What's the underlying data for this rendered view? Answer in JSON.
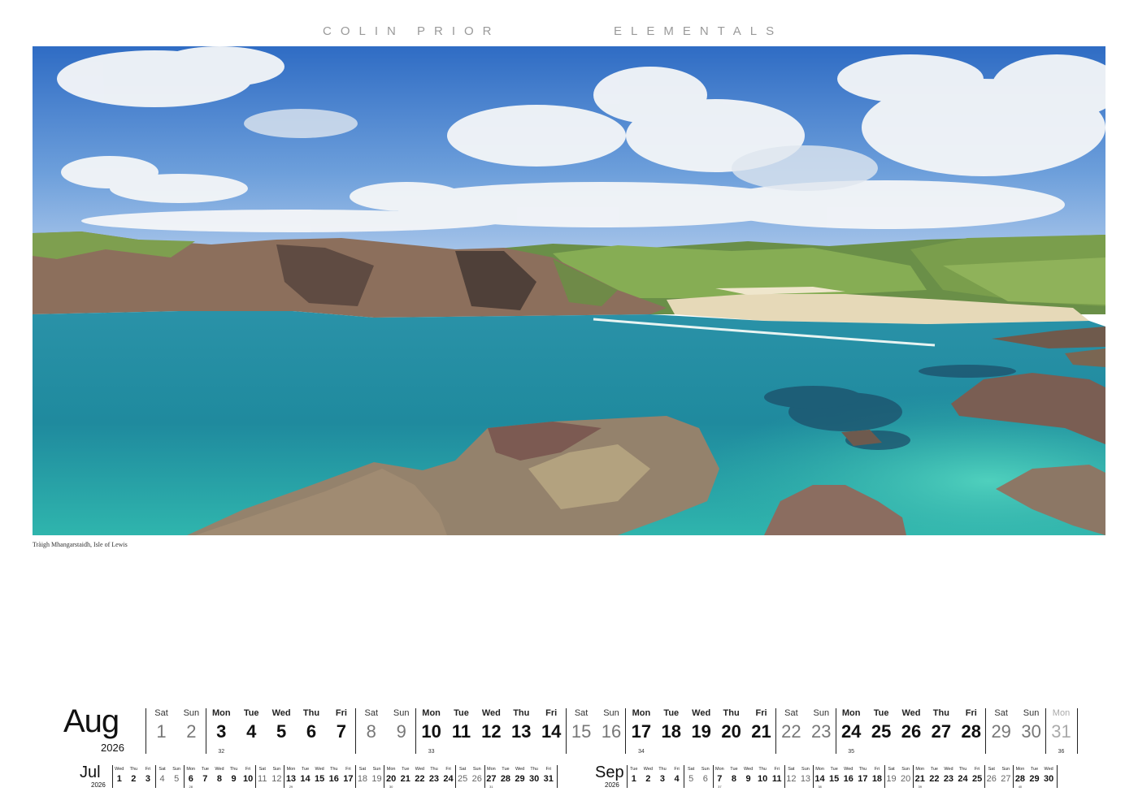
{
  "header": {
    "artist": "COLIN PRIOR",
    "series": "ELEMENTALS"
  },
  "photo": {
    "caption": "Tràigh Mhangarstaidh, Isle of Lewis"
  },
  "colors": {
    "sky": "#3f78c8",
    "water": "#1f8fa0",
    "turquoise": "#37c0b3",
    "rock": "#8a6d5e",
    "grass": "#7fa347",
    "sand": "#e8dcc0"
  },
  "main_month": {
    "name": "Aug",
    "year": "2026",
    "days": [
      {
        "dn": "Sat",
        "d": "1",
        "type": "we"
      },
      {
        "dn": "Sun",
        "d": "2",
        "type": "we"
      },
      {
        "dn": "Mon",
        "d": "3",
        "type": "wk",
        "wn": "32"
      },
      {
        "dn": "Tue",
        "d": "4",
        "type": "wk"
      },
      {
        "dn": "Wed",
        "d": "5",
        "type": "wk"
      },
      {
        "dn": "Thu",
        "d": "6",
        "type": "wk"
      },
      {
        "dn": "Fri",
        "d": "7",
        "type": "wk"
      },
      {
        "dn": "Sat",
        "d": "8",
        "type": "we"
      },
      {
        "dn": "Sun",
        "d": "9",
        "type": "we"
      },
      {
        "dn": "Mon",
        "d": "10",
        "type": "wk",
        "wn": "33"
      },
      {
        "dn": "Tue",
        "d": "11",
        "type": "wk"
      },
      {
        "dn": "Wed",
        "d": "12",
        "type": "wk"
      },
      {
        "dn": "Thu",
        "d": "13",
        "type": "wk"
      },
      {
        "dn": "Fri",
        "d": "14",
        "type": "wk"
      },
      {
        "dn": "Sat",
        "d": "15",
        "type": "we"
      },
      {
        "dn": "Sun",
        "d": "16",
        "type": "we"
      },
      {
        "dn": "Mon",
        "d": "17",
        "type": "wk",
        "wn": "34"
      },
      {
        "dn": "Tue",
        "d": "18",
        "type": "wk"
      },
      {
        "dn": "Wed",
        "d": "19",
        "type": "wk"
      },
      {
        "dn": "Thu",
        "d": "20",
        "type": "wk"
      },
      {
        "dn": "Fri",
        "d": "21",
        "type": "wk"
      },
      {
        "dn": "Sat",
        "d": "22",
        "type": "we"
      },
      {
        "dn": "Sun",
        "d": "23",
        "type": "we"
      },
      {
        "dn": "Mon",
        "d": "24",
        "type": "wk",
        "wn": "35"
      },
      {
        "dn": "Tue",
        "d": "25",
        "type": "wk"
      },
      {
        "dn": "Wed",
        "d": "26",
        "type": "wk"
      },
      {
        "dn": "Thu",
        "d": "27",
        "type": "wk"
      },
      {
        "dn": "Fri",
        "d": "28",
        "type": "wk"
      },
      {
        "dn": "Sat",
        "d": "29",
        "type": "we"
      },
      {
        "dn": "Sun",
        "d": "30",
        "type": "we"
      },
      {
        "dn": "Mon",
        "d": "31",
        "type": "next",
        "wn": "36"
      }
    ]
  },
  "prev_month": {
    "name": "Jul",
    "year": "2026",
    "days": [
      {
        "dn": "Wed",
        "d": "1",
        "type": "wk"
      },
      {
        "dn": "Thu",
        "d": "2",
        "type": "wk"
      },
      {
        "dn": "Fri",
        "d": "3",
        "type": "wk"
      },
      {
        "dn": "Sat",
        "d": "4",
        "type": "we"
      },
      {
        "dn": "Sun",
        "d": "5",
        "type": "we"
      },
      {
        "dn": "Mon",
        "d": "6",
        "type": "wk",
        "wn": "28"
      },
      {
        "dn": "Tue",
        "d": "7",
        "type": "wk"
      },
      {
        "dn": "Wed",
        "d": "8",
        "type": "wk"
      },
      {
        "dn": "Thu",
        "d": "9",
        "type": "wk"
      },
      {
        "dn": "Fri",
        "d": "10",
        "type": "wk"
      },
      {
        "dn": "Sat",
        "d": "11",
        "type": "we"
      },
      {
        "dn": "Sun",
        "d": "12",
        "type": "we"
      },
      {
        "dn": "Mon",
        "d": "13",
        "type": "wk",
        "wn": "29"
      },
      {
        "dn": "Tue",
        "d": "14",
        "type": "wk"
      },
      {
        "dn": "Wed",
        "d": "15",
        "type": "wk"
      },
      {
        "dn": "Thu",
        "d": "16",
        "type": "wk"
      },
      {
        "dn": "Fri",
        "d": "17",
        "type": "wk"
      },
      {
        "dn": "Sat",
        "d": "18",
        "type": "we"
      },
      {
        "dn": "Sun",
        "d": "19",
        "type": "we"
      },
      {
        "dn": "Mon",
        "d": "20",
        "type": "wk",
        "wn": "30"
      },
      {
        "dn": "Tue",
        "d": "21",
        "type": "wk"
      },
      {
        "dn": "Wed",
        "d": "22",
        "type": "wk"
      },
      {
        "dn": "Thu",
        "d": "23",
        "type": "wk"
      },
      {
        "dn": "Fri",
        "d": "24",
        "type": "wk"
      },
      {
        "dn": "Sat",
        "d": "25",
        "type": "we"
      },
      {
        "dn": "Sun",
        "d": "26",
        "type": "we"
      },
      {
        "dn": "Mon",
        "d": "27",
        "type": "wk",
        "wn": "31"
      },
      {
        "dn": "Tue",
        "d": "28",
        "type": "wk"
      },
      {
        "dn": "Wed",
        "d": "29",
        "type": "wk"
      },
      {
        "dn": "Thu",
        "d": "30",
        "type": "wk"
      },
      {
        "dn": "Fri",
        "d": "31",
        "type": "wk"
      }
    ]
  },
  "next_month": {
    "name": "Sep",
    "year": "2026",
    "days": [
      {
        "dn": "Tue",
        "d": "1",
        "type": "wk"
      },
      {
        "dn": "Wed",
        "d": "2",
        "type": "wk"
      },
      {
        "dn": "Thu",
        "d": "3",
        "type": "wk"
      },
      {
        "dn": "Fri",
        "d": "4",
        "type": "wk"
      },
      {
        "dn": "Sat",
        "d": "5",
        "type": "we"
      },
      {
        "dn": "Sun",
        "d": "6",
        "type": "we"
      },
      {
        "dn": "Mon",
        "d": "7",
        "type": "wk",
        "wn": "37"
      },
      {
        "dn": "Tue",
        "d": "8",
        "type": "wk"
      },
      {
        "dn": "Wed",
        "d": "9",
        "type": "wk"
      },
      {
        "dn": "Thu",
        "d": "10",
        "type": "wk"
      },
      {
        "dn": "Fri",
        "d": "11",
        "type": "wk"
      },
      {
        "dn": "Sat",
        "d": "12",
        "type": "we"
      },
      {
        "dn": "Sun",
        "d": "13",
        "type": "we"
      },
      {
        "dn": "Mon",
        "d": "14",
        "type": "wk",
        "wn": "38"
      },
      {
        "dn": "Tue",
        "d": "15",
        "type": "wk"
      },
      {
        "dn": "Wed",
        "d": "16",
        "type": "wk"
      },
      {
        "dn": "Thu",
        "d": "17",
        "type": "wk"
      },
      {
        "dn": "Fri",
        "d": "18",
        "type": "wk"
      },
      {
        "dn": "Sat",
        "d": "19",
        "type": "we"
      },
      {
        "dn": "Sun",
        "d": "20",
        "type": "we"
      },
      {
        "dn": "Mon",
        "d": "21",
        "type": "wk",
        "wn": "39"
      },
      {
        "dn": "Tue",
        "d": "22",
        "type": "wk"
      },
      {
        "dn": "Wed",
        "d": "23",
        "type": "wk"
      },
      {
        "dn": "Thu",
        "d": "24",
        "type": "wk"
      },
      {
        "dn": "Fri",
        "d": "25",
        "type": "wk"
      },
      {
        "dn": "Sat",
        "d": "26",
        "type": "we"
      },
      {
        "dn": "Sun",
        "d": "27",
        "type": "we"
      },
      {
        "dn": "Mon",
        "d": "28",
        "type": "wk",
        "wn": "40"
      },
      {
        "dn": "Tue",
        "d": "29",
        "type": "wk"
      },
      {
        "dn": "Wed",
        "d": "30",
        "type": "wk"
      }
    ]
  }
}
